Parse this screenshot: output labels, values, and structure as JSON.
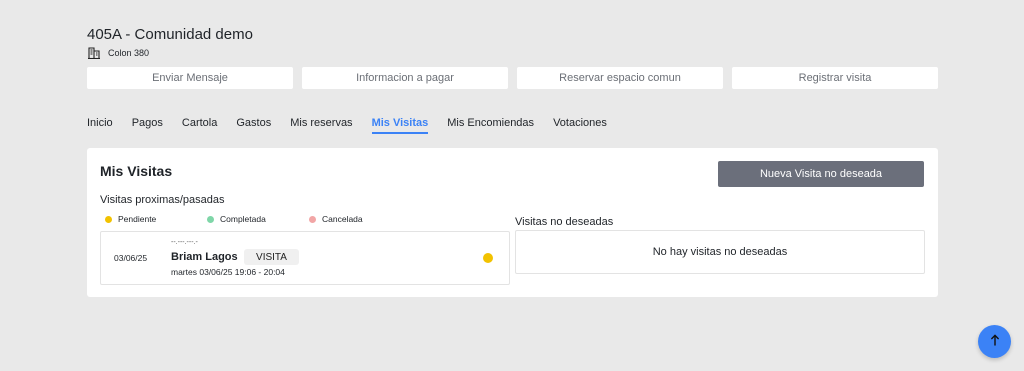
{
  "header": {
    "title": "405A - Comunidad demo",
    "address": "Colon 380"
  },
  "actions": [
    "Enviar Mensaje",
    "Informacion a pagar",
    "Reservar espacio comun",
    "Registrar visita"
  ],
  "tabs": [
    {
      "label": "Inicio",
      "active": false
    },
    {
      "label": "Pagos",
      "active": false
    },
    {
      "label": "Cartola",
      "active": false
    },
    {
      "label": "Gastos",
      "active": false
    },
    {
      "label": "Mis reservas",
      "active": false
    },
    {
      "label": "Mis Visitas",
      "active": true
    },
    {
      "label": "Mis Encomiendas",
      "active": false
    },
    {
      "label": "Votaciones",
      "active": false
    }
  ],
  "visitas": {
    "title": "Mis Visitas",
    "new_button": "Nueva Visita no deseada",
    "subtitle": "Visitas proximas/pasadas",
    "legend": [
      {
        "label": "Pendiente",
        "color": "#f2c200"
      },
      {
        "label": "Completada",
        "color": "#7fd6a8"
      },
      {
        "label": "Cancelada",
        "color": "#f2a6a6"
      }
    ],
    "items": [
      {
        "date": "03/06/25",
        "code": "--.---.---.-",
        "name": "Briam Lagos",
        "badge": "VISITA",
        "time": "martes 03/06/25 19:06 - 20:04",
        "status_color": "#f2c200"
      }
    ]
  },
  "unwanted": {
    "title": "Visitas no deseadas",
    "empty_text": "No hay visitas no deseadas"
  },
  "colors": {
    "accent": "#3b82f6",
    "background": "#e9e9e9",
    "button_dark": "#6b6f7b"
  }
}
